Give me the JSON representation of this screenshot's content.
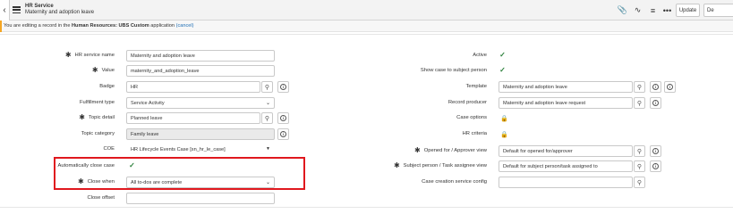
{
  "header": {
    "title": "HR Service",
    "subtitle": "Maternity and adoption leave",
    "update_label": "Update",
    "delete_label": "De",
    "icons": [
      "paperclip-icon",
      "activity-icon",
      "sliders-icon",
      "more-icon"
    ]
  },
  "notice": {
    "prefix": "You are editing a record in the ",
    "scope": "Human Resources: UBS Custom",
    "middle": " application ",
    "link": "(cancel)"
  },
  "form": {
    "hr_service_name_label": "HR service name",
    "hr_service_name_value": "Maternity and adoption leave",
    "value_label": "Value",
    "value_value": "maternity_and_adoption_leave",
    "badge_label": "Badge",
    "badge_value": "HR",
    "fulfillment_type_label": "Fulfillment type",
    "fulfillment_type_value": "Service Activity",
    "topic_detail_label": "Topic detail",
    "topic_detail_value": "Planned leave",
    "topic_category_label": "Topic category",
    "topic_category_value": "Family leave",
    "coe_label": "COE",
    "coe_value": "HR Lifecycle Events Case [sn_hr_le_case]",
    "auto_close_label": "Automatically close case",
    "auto_close_checked": true,
    "close_when_label": "Close when",
    "close_when_value": "All to-dos are complete",
    "close_offset_label": "Close offset",
    "close_offset_value": "",
    "active_label": "Active",
    "active_checked": true,
    "show_case_label": "Show case to subject person",
    "show_case_checked": true,
    "template_label": "Template",
    "template_value": "Maternity and adoption leave",
    "record_producer_label": "Record producer",
    "record_producer_value": "Maternity and adoption leave request",
    "case_options_label": "Case options",
    "hr_criteria_label": "HR criteria",
    "opened_for_view_label": "Opened for / Approver view",
    "opened_for_view_value": "Default for opened for/approver",
    "subject_view_label": "Subject person / Task assignee view",
    "subject_view_value": "Default for subject person/task assigned to",
    "case_creation_label": "Case creation service config",
    "case_creation_value": ""
  },
  "colors": {
    "highlight": "#e0181e",
    "check": "#2a7f3a",
    "notice_accent": "#f5a623"
  }
}
